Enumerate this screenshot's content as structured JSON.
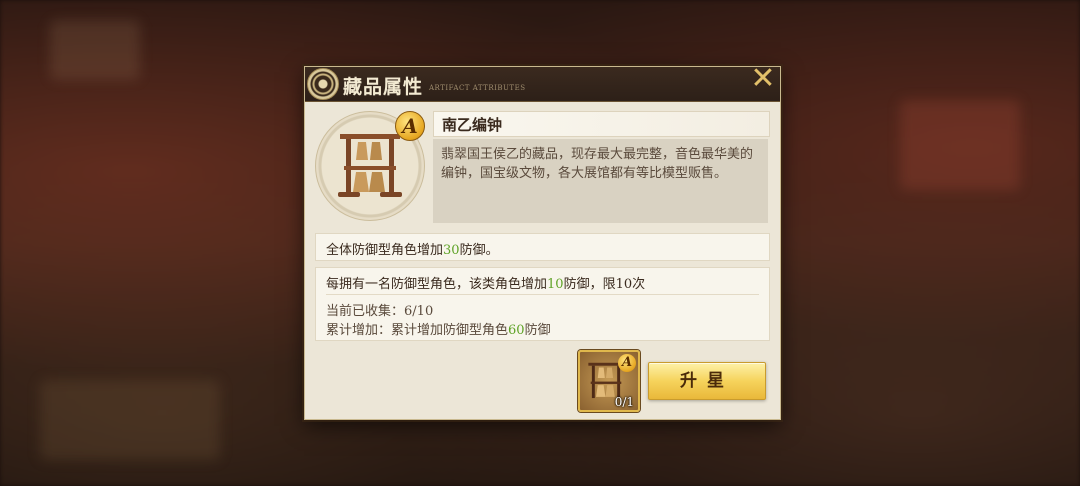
{
  "header": {
    "title": "藏品属性",
    "subtitle": "ARTIFACT ATTRIBUTES"
  },
  "artifact": {
    "name": "南乙编钟",
    "grade": "A",
    "description": "翡翠国王侯乙的藏品，现存最大最完整，音色最华美的编钟，国宝级文物，各大展馆都有等比模型贩售。"
  },
  "effect1": {
    "prefix": "全体防御型角色增加",
    "value": "30",
    "suffix": "防御。"
  },
  "effect2": {
    "prefix": "每拥有一名防御型角色，该类角色增加",
    "value": "10",
    "suffix": "防御，限10次",
    "collected_label": "当前已收集：",
    "collected_value": "6/10",
    "total_label": "累计增加：",
    "total_prefix": "累计增加防御型角色",
    "total_value": "60",
    "total_suffix": "防御"
  },
  "material": {
    "grade": "A",
    "count": "0/1"
  },
  "upgrade_button": "升星",
  "colors": {
    "highlight_green": "#5fa327",
    "gold_accent": "#e2c06a",
    "header_bg": "#2d2018"
  }
}
